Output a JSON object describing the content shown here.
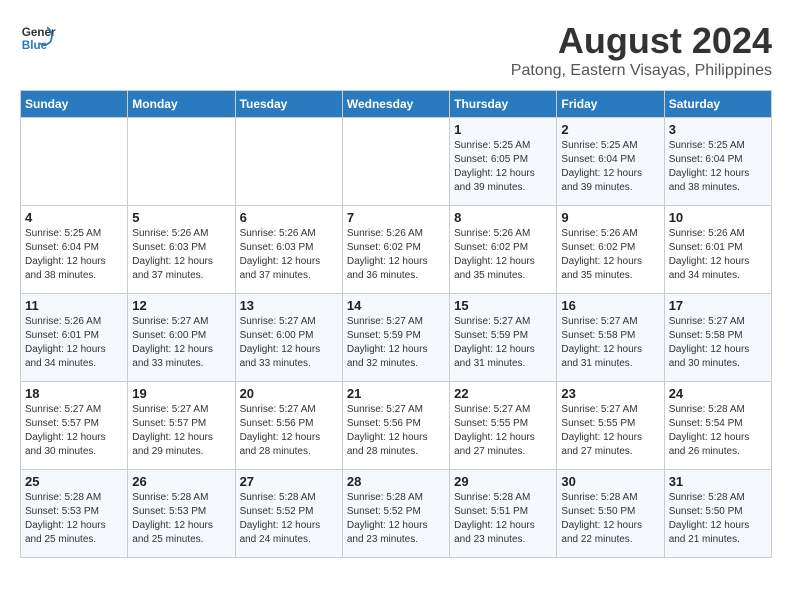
{
  "header": {
    "logo_line1": "General",
    "logo_line2": "Blue",
    "title": "August 2024",
    "subtitle": "Patong, Eastern Visayas, Philippines"
  },
  "weekdays": [
    "Sunday",
    "Monday",
    "Tuesday",
    "Wednesday",
    "Thursday",
    "Friday",
    "Saturday"
  ],
  "weeks": [
    [
      {
        "day": "",
        "info": ""
      },
      {
        "day": "",
        "info": ""
      },
      {
        "day": "",
        "info": ""
      },
      {
        "day": "",
        "info": ""
      },
      {
        "day": "1",
        "info": "Sunrise: 5:25 AM\nSunset: 6:05 PM\nDaylight: 12 hours\nand 39 minutes."
      },
      {
        "day": "2",
        "info": "Sunrise: 5:25 AM\nSunset: 6:04 PM\nDaylight: 12 hours\nand 39 minutes."
      },
      {
        "day": "3",
        "info": "Sunrise: 5:25 AM\nSunset: 6:04 PM\nDaylight: 12 hours\nand 38 minutes."
      }
    ],
    [
      {
        "day": "4",
        "info": "Sunrise: 5:25 AM\nSunset: 6:04 PM\nDaylight: 12 hours\nand 38 minutes."
      },
      {
        "day": "5",
        "info": "Sunrise: 5:26 AM\nSunset: 6:03 PM\nDaylight: 12 hours\nand 37 minutes."
      },
      {
        "day": "6",
        "info": "Sunrise: 5:26 AM\nSunset: 6:03 PM\nDaylight: 12 hours\nand 37 minutes."
      },
      {
        "day": "7",
        "info": "Sunrise: 5:26 AM\nSunset: 6:02 PM\nDaylight: 12 hours\nand 36 minutes."
      },
      {
        "day": "8",
        "info": "Sunrise: 5:26 AM\nSunset: 6:02 PM\nDaylight: 12 hours\nand 35 minutes."
      },
      {
        "day": "9",
        "info": "Sunrise: 5:26 AM\nSunset: 6:02 PM\nDaylight: 12 hours\nand 35 minutes."
      },
      {
        "day": "10",
        "info": "Sunrise: 5:26 AM\nSunset: 6:01 PM\nDaylight: 12 hours\nand 34 minutes."
      }
    ],
    [
      {
        "day": "11",
        "info": "Sunrise: 5:26 AM\nSunset: 6:01 PM\nDaylight: 12 hours\nand 34 minutes."
      },
      {
        "day": "12",
        "info": "Sunrise: 5:27 AM\nSunset: 6:00 PM\nDaylight: 12 hours\nand 33 minutes."
      },
      {
        "day": "13",
        "info": "Sunrise: 5:27 AM\nSunset: 6:00 PM\nDaylight: 12 hours\nand 33 minutes."
      },
      {
        "day": "14",
        "info": "Sunrise: 5:27 AM\nSunset: 5:59 PM\nDaylight: 12 hours\nand 32 minutes."
      },
      {
        "day": "15",
        "info": "Sunrise: 5:27 AM\nSunset: 5:59 PM\nDaylight: 12 hours\nand 31 minutes."
      },
      {
        "day": "16",
        "info": "Sunrise: 5:27 AM\nSunset: 5:58 PM\nDaylight: 12 hours\nand 31 minutes."
      },
      {
        "day": "17",
        "info": "Sunrise: 5:27 AM\nSunset: 5:58 PM\nDaylight: 12 hours\nand 30 minutes."
      }
    ],
    [
      {
        "day": "18",
        "info": "Sunrise: 5:27 AM\nSunset: 5:57 PM\nDaylight: 12 hours\nand 30 minutes."
      },
      {
        "day": "19",
        "info": "Sunrise: 5:27 AM\nSunset: 5:57 PM\nDaylight: 12 hours\nand 29 minutes."
      },
      {
        "day": "20",
        "info": "Sunrise: 5:27 AM\nSunset: 5:56 PM\nDaylight: 12 hours\nand 28 minutes."
      },
      {
        "day": "21",
        "info": "Sunrise: 5:27 AM\nSunset: 5:56 PM\nDaylight: 12 hours\nand 28 minutes."
      },
      {
        "day": "22",
        "info": "Sunrise: 5:27 AM\nSunset: 5:55 PM\nDaylight: 12 hours\nand 27 minutes."
      },
      {
        "day": "23",
        "info": "Sunrise: 5:27 AM\nSunset: 5:55 PM\nDaylight: 12 hours\nand 27 minutes."
      },
      {
        "day": "24",
        "info": "Sunrise: 5:28 AM\nSunset: 5:54 PM\nDaylight: 12 hours\nand 26 minutes."
      }
    ],
    [
      {
        "day": "25",
        "info": "Sunrise: 5:28 AM\nSunset: 5:53 PM\nDaylight: 12 hours\nand 25 minutes."
      },
      {
        "day": "26",
        "info": "Sunrise: 5:28 AM\nSunset: 5:53 PM\nDaylight: 12 hours\nand 25 minutes."
      },
      {
        "day": "27",
        "info": "Sunrise: 5:28 AM\nSunset: 5:52 PM\nDaylight: 12 hours\nand 24 minutes."
      },
      {
        "day": "28",
        "info": "Sunrise: 5:28 AM\nSunset: 5:52 PM\nDaylight: 12 hours\nand 23 minutes."
      },
      {
        "day": "29",
        "info": "Sunrise: 5:28 AM\nSunset: 5:51 PM\nDaylight: 12 hours\nand 23 minutes."
      },
      {
        "day": "30",
        "info": "Sunrise: 5:28 AM\nSunset: 5:50 PM\nDaylight: 12 hours\nand 22 minutes."
      },
      {
        "day": "31",
        "info": "Sunrise: 5:28 AM\nSunset: 5:50 PM\nDaylight: 12 hours\nand 21 minutes."
      }
    ]
  ]
}
